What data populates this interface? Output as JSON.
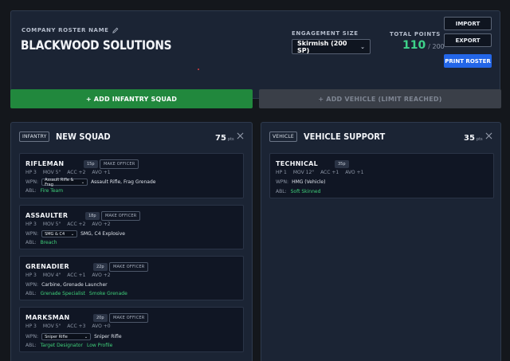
{
  "header": {
    "roster_label": "COMPANY ROSTER NAME",
    "company_name": "BLACKWOOD SOLUTIONS",
    "engagement_label": "ENGAGEMENT SIZE",
    "engagement_value": "Skirmish (200 SP)",
    "total_points_label": "TOTAL POINTS",
    "total_points": "110",
    "max_points": "/ 200",
    "import_label": "IMPORT",
    "export_label": "EXPORT",
    "print_label": "PRINT ROSTER"
  },
  "actions": {
    "add_infantry": "+ ADD INFANTRY SQUAD",
    "add_vehicle": "+ ADD VEHICLE (LIMIT REACHED)"
  },
  "infantry": {
    "tag": "INFANTRY",
    "title": "NEW SQUAD",
    "points": "75",
    "points_unit": "pts",
    "units": [
      {
        "name": "RIFLEMAN",
        "cost": "15p",
        "officer": "MAKE OFFICER",
        "stats": [
          "HP 3",
          "MOV 5\"",
          "ACC +2",
          "AVO +1"
        ],
        "wpn_label": "WPN:",
        "select": "Assault Rifle & Frag",
        "weapons": "Assault Rifle,  Frag Grenade",
        "abl_label": "ABL:",
        "abilities": [
          "Fire Team"
        ]
      },
      {
        "name": "ASSAULTER",
        "cost": "18p",
        "officer": "MAKE OFFICER",
        "stats": [
          "HP 3",
          "MOV 5\"",
          "ACC +2",
          "AVO +2"
        ],
        "wpn_label": "WPN:",
        "select": "SMG & C4",
        "weapons": "SMG,  C4 Explosive",
        "abl_label": "ABL:",
        "abilities": [
          "Breach"
        ]
      },
      {
        "name": "GRENADIER",
        "cost": "22p",
        "officer": "MAKE OFFICER",
        "stats": [
          "HP 3",
          "MOV 4\"",
          "ACC +1",
          "AVO +2"
        ],
        "wpn_label": "WPN:",
        "select": "",
        "weapons": "Carbine,  Grenade Launcher",
        "abl_label": "ABL:",
        "abilities": [
          "Grenade Specialist",
          "Smoke Grenade"
        ]
      },
      {
        "name": "MARKSMAN",
        "cost": "20p",
        "officer": "MAKE OFFICER",
        "stats": [
          "HP 3",
          "MOV 5\"",
          "ACC +3",
          "AVO +0"
        ],
        "wpn_label": "WPN:",
        "select": "Sniper Rifle",
        "weapons": "Sniper Rifle",
        "abl_label": "ABL:",
        "abilities": [
          "Target Designator",
          "Low Profile"
        ]
      }
    ]
  },
  "vehicle": {
    "tag": "VEHICLE",
    "title": "VEHICLE SUPPORT",
    "points": "35",
    "points_unit": "pts",
    "unit": {
      "name": "TECHNICAL",
      "cost": "35p",
      "stats": [
        "HP 1",
        "MOV 12\"",
        "ACC +1",
        "AVO +1"
      ],
      "wpn_label": "WPN:",
      "weapons": "HMG (Vehicle)",
      "abl_label": "ABL:",
      "abilities": [
        "Soft Skinned"
      ]
    }
  }
}
